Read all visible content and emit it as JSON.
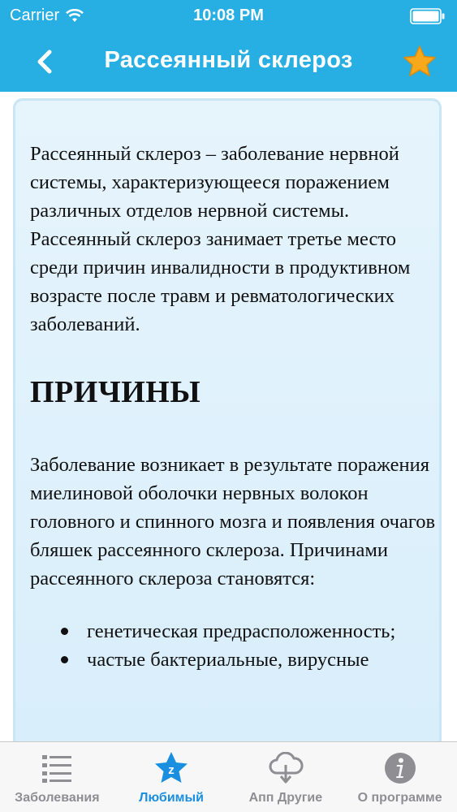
{
  "status_bar": {
    "carrier": "Carrier",
    "time": "10:08 PM"
  },
  "nav": {
    "title": "Рассеянный склероз",
    "back_icon": "chevron-left-icon",
    "favorite_icon": "star-icon"
  },
  "article": {
    "intro": "Рассеянный склероз – заболевание нервной системы, характеризующееся поражением различных отделов нервной системы. Рассеянный склероз занимает третье место среди причин инвалидности в продуктивном возрасте после травм и ревматологических заболеваний.",
    "heading": "ПРИЧИНЫ",
    "causes_text": "Заболевание возникает в результате поражения миелиновой оболочки нервных волокон головного и спинного мозга и появления очагов бляшек рассеянного склероза. Причинами рассеянного склероза становятся:",
    "bullets": [
      "генетическая предрасположенность;",
      "частые бактериальные, вирусные"
    ]
  },
  "tabs": [
    {
      "label": "Заболевания",
      "icon": "list-icon",
      "active": false
    },
    {
      "label": "Любимый",
      "icon": "star-badge-icon",
      "active": true
    },
    {
      "label": "Апп Другие",
      "icon": "cloud-download-icon",
      "active": false
    },
    {
      "label": "О программе",
      "icon": "info-icon",
      "active": false
    }
  ],
  "colors": {
    "header": "#27aee3",
    "card_bg": "#e6f4fc",
    "tab_active": "#1a8fe0",
    "tab_inactive": "#8e8e93",
    "star": "#f7a81b"
  }
}
